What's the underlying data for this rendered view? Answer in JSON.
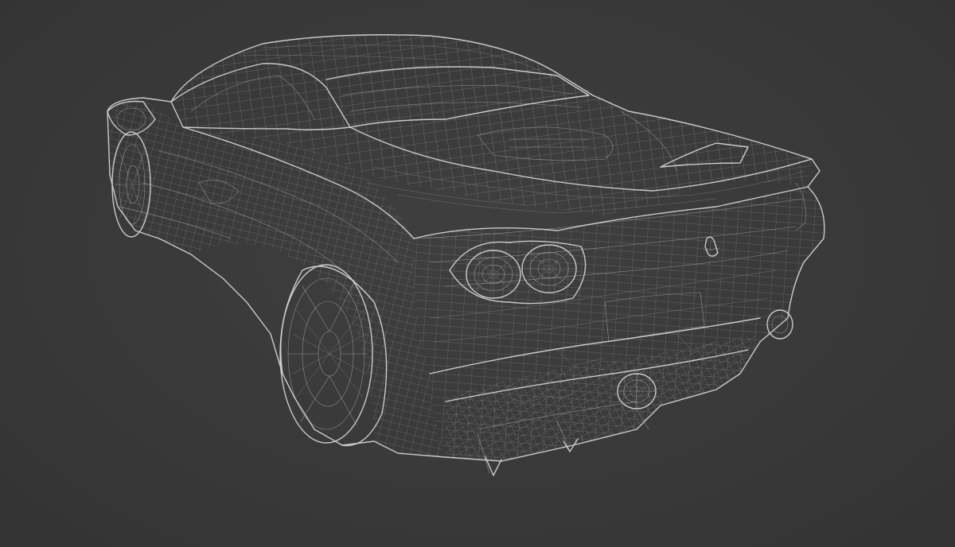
{
  "scene": {
    "subject": "car-wireframe",
    "background_color": "#3a3a3a",
    "wire_color": "#d2d2d2"
  }
}
